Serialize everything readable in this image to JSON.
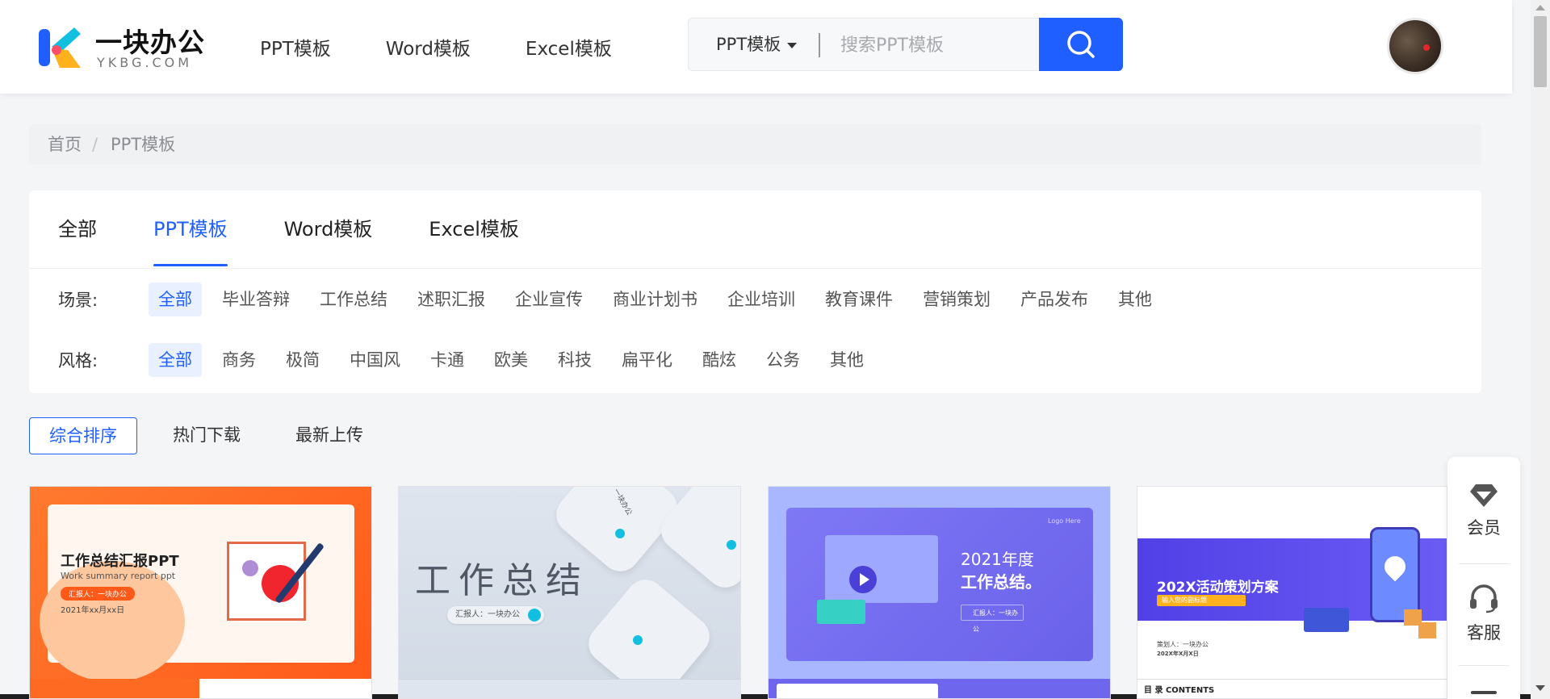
{
  "header": {
    "logo": {
      "text": "一块办公",
      "subtext": "YKBG.COM"
    },
    "nav": [
      "PPT模板",
      "Word模板",
      "Excel模板"
    ],
    "search": {
      "category": "PPT模板",
      "placeholder": "搜索PPT模板",
      "value": ""
    }
  },
  "breadcrumb": {
    "home": "首页",
    "separator": "/",
    "current": "PPT模板"
  },
  "tabs": {
    "items": [
      "全部",
      "PPT模板",
      "Word模板",
      "Excel模板"
    ],
    "active_index": 1
  },
  "filters": {
    "scene": {
      "label": "场景:",
      "options": [
        "全部",
        "毕业答辩",
        "工作总结",
        "述职汇报",
        "企业宣传",
        "商业计划书",
        "企业培训",
        "教育课件",
        "营销策划",
        "产品发布",
        "其他"
      ],
      "active_index": 0
    },
    "style": {
      "label": "风格:",
      "options": [
        "全部",
        "商务",
        "极简",
        "中国风",
        "卡通",
        "欧美",
        "科技",
        "扁平化",
        "酷炫",
        "公务",
        "其他"
      ],
      "active_index": 0
    }
  },
  "sort": {
    "options": [
      "综合排序",
      "热门下载",
      "最新上传"
    ],
    "active_index": 0
  },
  "templates": [
    {
      "title": "工作总结汇报PPT",
      "subtitle": "Work summary report ppt",
      "reporter": "汇报人：一块办公",
      "date": "2021年xx月xx日"
    },
    {
      "title": "工作总结",
      "reporter": "汇报人：一块办公",
      "corner": "一块办公"
    },
    {
      "year": "2021年度",
      "title": "工作总结。",
      "reporter": "汇报人：一块办公",
      "corner": "Logo Here"
    },
    {
      "title": "202X活动策划方案",
      "subtitle": "输入您的副标题",
      "reporter": "策划人：一块办公",
      "date": "202X年X月X日",
      "footer": "目 录   CONTENTS"
    }
  ],
  "float_panel": {
    "items": [
      "会员",
      "客服"
    ]
  },
  "colors": {
    "accent": "#1f5fff",
    "active_bg": "#e9f0ff"
  }
}
